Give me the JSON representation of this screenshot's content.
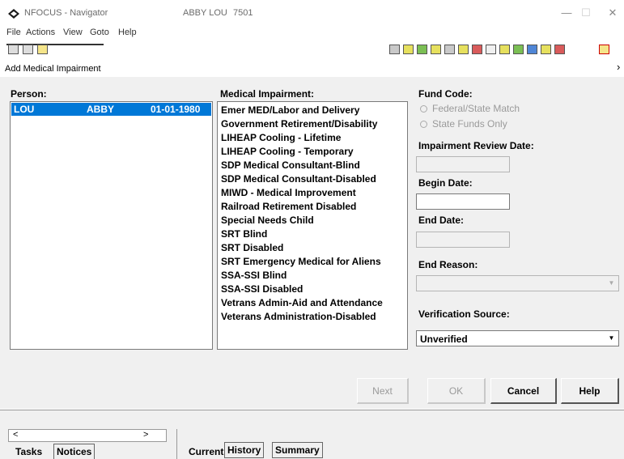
{
  "window": {
    "app_title": "NFOCUS - Navigator",
    "person_name": "ABBY LOU",
    "case_number": "7501",
    "minimize_glyph": "—",
    "maximize_glyph": "☐",
    "close_glyph": "✕"
  },
  "menu": [
    "File",
    "Actions",
    "View",
    "Goto",
    "Help"
  ],
  "dialog": {
    "title": "Add Medical Impairment",
    "close_glyph": "›"
  },
  "person": {
    "label": "Person:",
    "rows": [
      {
        "last": "LOU",
        "first": "ABBY",
        "dob": "01-01-1980"
      }
    ]
  },
  "impairment": {
    "label": "Medical Impairment:",
    "items": [
      "Emer MED/Labor and Delivery",
      "Government Retirement/Disability",
      "LIHEAP Cooling - Lifetime",
      "LIHEAP Cooling - Temporary",
      "SDP Medical Consultant-Blind",
      "SDP Medical Consultant-Disabled",
      "MIWD - Medical Improvement",
      "Railroad Retirement Disabled",
      "Special Needs Child",
      "SRT Blind",
      "SRT Disabled",
      "SRT Emergency Medical for Aliens",
      "SSA-SSI Blind",
      "SSA-SSI Disabled",
      "Vetrans Admin-Aid and Attendance",
      "Veterans Administration-Disabled"
    ]
  },
  "fund_code": {
    "label": "Fund Code:",
    "options": [
      "Federal/State Match",
      "State Funds Only"
    ]
  },
  "impairment_review_date": {
    "label": "Impairment Review Date:",
    "value": ""
  },
  "begin_date": {
    "label": "Begin Date:",
    "value": ""
  },
  "end_date": {
    "label": "End Date:",
    "value": ""
  },
  "end_reason": {
    "label": "End Reason:",
    "value": ""
  },
  "verification_source": {
    "label": "Verification Source:",
    "value": "Unverified"
  },
  "buttons": {
    "next": "Next",
    "ok": "OK",
    "cancel": "Cancel",
    "help": "Help"
  },
  "bottom": {
    "scroll_left": "<",
    "scroll_right": ">",
    "left_tabs": [
      "Tasks",
      "Notices"
    ],
    "right_tabs": [
      "Current",
      "History",
      "Summary"
    ]
  }
}
